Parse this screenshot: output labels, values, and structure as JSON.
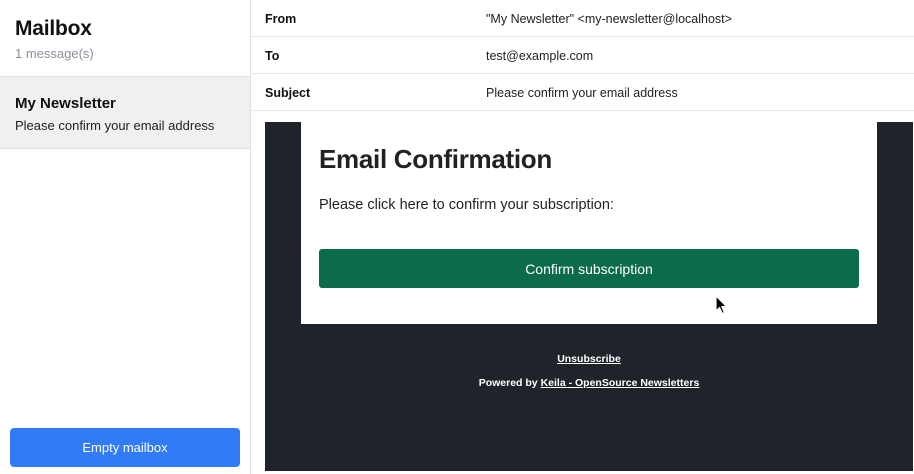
{
  "sidebar": {
    "title": "Mailbox",
    "count": "1 message(s)",
    "messages": [
      {
        "sender": "My Newsletter",
        "subject": "Please confirm your email address"
      }
    ],
    "empty_button": "Empty mailbox"
  },
  "headers": {
    "from_label": "From",
    "from_value": "\"My Newsletter\" <my-newsletter@localhost>",
    "to_label": "To",
    "to_value": "test@example.com",
    "subject_label": "Subject",
    "subject_value": "Please confirm your email address"
  },
  "email": {
    "heading": "Email Confirmation",
    "body": "Please click here to confirm your subscription:",
    "button": "Confirm subscription",
    "unsubscribe": "Unsubscribe",
    "powered_prefix": "Powered by ",
    "powered_link": "Keila - OpenSource Newsletters"
  },
  "colors": {
    "primary_button": "#2f7cf6",
    "confirm_button": "#0b6b4d",
    "email_background": "#1f242b",
    "selected_item": "#eff0f2"
  },
  "icons": {
    "cursor": "mouse-pointer-icon"
  }
}
